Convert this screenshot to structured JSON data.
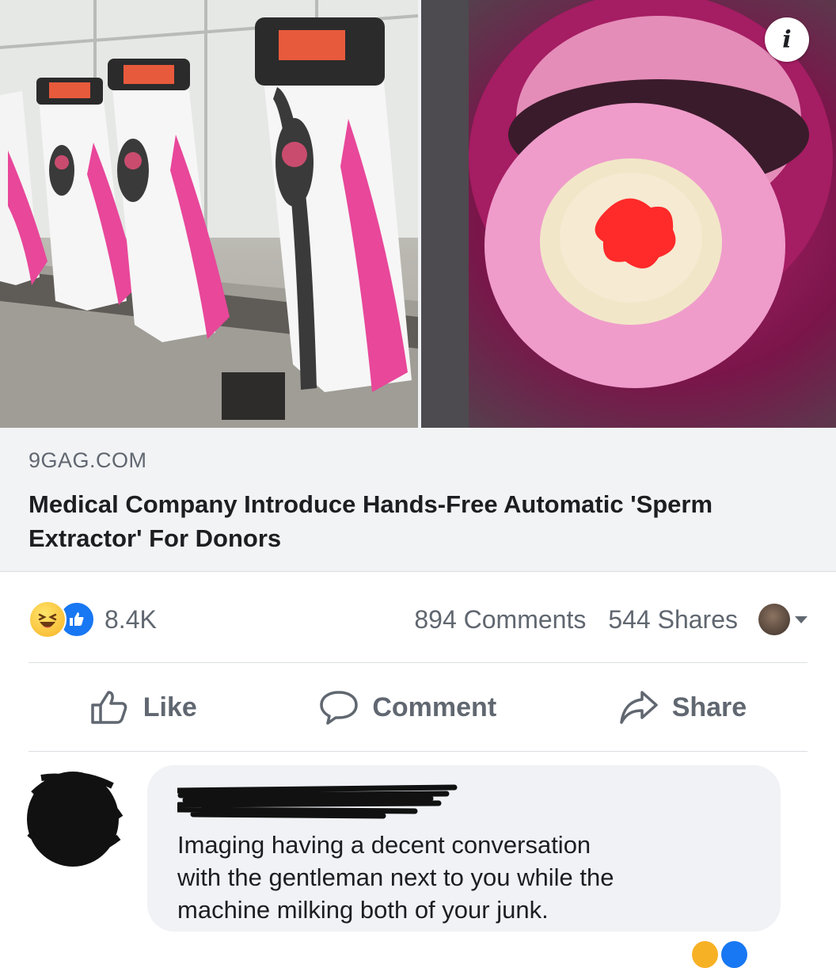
{
  "link_preview": {
    "domain": "9GAG.COM",
    "headline": "Medical Company Introduce Hands-Free Automatic 'Sperm Extractor' For Donors",
    "info_icon": "info-icon"
  },
  "summary": {
    "reactions": [
      "haha",
      "like"
    ],
    "reaction_count": "8.4K",
    "comments_label": "894 Comments",
    "shares_label": "544 Shares"
  },
  "actions": {
    "like_label": "Like",
    "comment_label": "Comment",
    "share_label": "Share"
  },
  "comment": {
    "author": "",
    "text": "Imaging having a decent conversation\nwith the gentleman next to you while the\nmachine milking both of your junk."
  },
  "colors": {
    "facebook_blue": "#1877f2",
    "meta_text": "#606770",
    "bubble_bg": "#f0f2f5",
    "device_pink": "#e8479a"
  }
}
